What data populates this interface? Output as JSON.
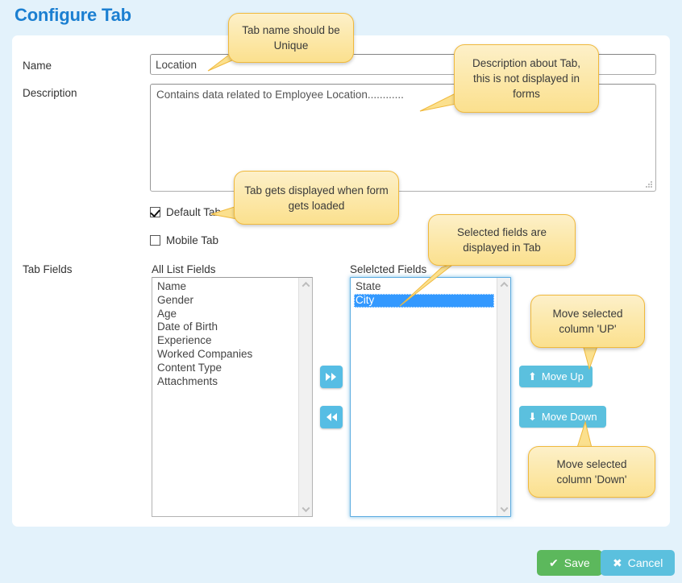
{
  "page": {
    "title": "Configure Tab",
    "background_color": "#e3f2fb",
    "title_color": "#1b7fd1"
  },
  "form": {
    "name_label": "Name",
    "name_value": "Location",
    "name_placeholder": "",
    "description_label": "Description",
    "description_value": "Contains data related to Employee Location............",
    "description_placeholder": "",
    "default_tab_label": "Default Tab",
    "default_tab_checked": true,
    "mobile_tab_label": "Mobile Tab",
    "mobile_tab_checked": false,
    "tab_fields_label": "Tab Fields"
  },
  "dual_list": {
    "all_caption": "All List Fields",
    "all_items": [
      "Name",
      "Gender",
      "Age",
      "Date of Birth",
      "Experience",
      "Worked Companies",
      "Content Type",
      "Attachments"
    ],
    "selected_caption": "Selelcted Fields",
    "selected_items": [
      "State",
      "City"
    ],
    "selected_highlight": "City",
    "highlight_color": "#3399ff",
    "add_icon": "double-chevron-right-icon",
    "remove_icon": "double-chevron-left-icon"
  },
  "move_buttons": {
    "up_label": "Move Up",
    "up_icon": "arrow-up-icon",
    "up_glyph": "⬆",
    "down_label": "Move Down",
    "down_icon": "arrow-down-icon",
    "down_glyph": "⬇",
    "color": "#5bc0de"
  },
  "footer": {
    "save_label": "Save",
    "save_icon": "check-icon",
    "save_glyph": "✔",
    "save_color": "#5cb85c",
    "cancel_label": "Cancel",
    "cancel_icon": "close-x-icon",
    "cancel_glyph": "✖",
    "cancel_color": "#5bc0de"
  },
  "callouts": {
    "name": "Tab name should be Unique",
    "description": "Description about Tab, this is not displayed in forms",
    "default_tab": "Tab gets displayed when  form gets loaded",
    "selected_fields": "Selected fields are displayed in Tab",
    "move_up": "Move selected column 'UP'",
    "move_down": "Move selected column 'Down'",
    "fill_color": "#fce9ad",
    "border_color": "#f0b93c"
  }
}
